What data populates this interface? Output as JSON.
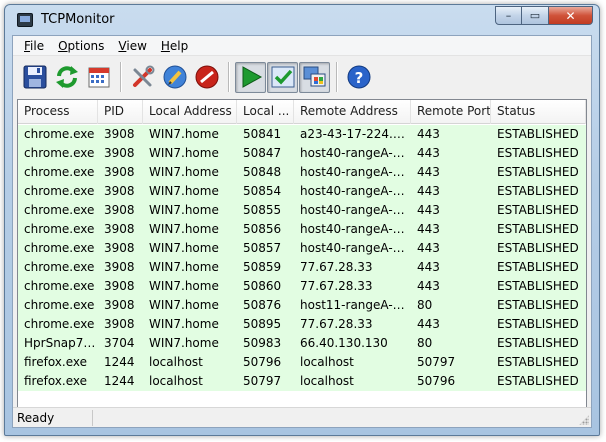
{
  "window": {
    "title": "TCPMonitor"
  },
  "caption": {
    "minimize": "–",
    "maximize": "▭",
    "close": "✕"
  },
  "menu": [
    {
      "label": "File",
      "mnemonic": "F",
      "rest": "ile"
    },
    {
      "label": "Options",
      "mnemonic": "O",
      "rest": "ptions"
    },
    {
      "label": "View",
      "mnemonic": "V",
      "rest": "iew"
    },
    {
      "label": "Help",
      "mnemonic": "H",
      "rest": "elp"
    }
  ],
  "toolbar": {
    "icons": [
      "save-icon",
      "refresh-icon",
      "calendar-icon",
      "tools-icon",
      "pencil-icon",
      "stop-icon",
      "play-icon",
      "check-icon",
      "windows-icon",
      "help-icon"
    ],
    "colors": {
      "save": "#2b4f9e",
      "refresh": "#1e9a2e",
      "play": "#1d9a30",
      "stop": "#c8241b",
      "help": "#2a63c9"
    }
  },
  "table": {
    "columns": [
      "Process",
      "PID",
      "Local Address",
      "Local ...",
      "Remote Address",
      "Remote Port",
      "Status"
    ],
    "row_color": "#e2fde2",
    "rows": [
      [
        "chrome.exe",
        "3908",
        "WIN7.home",
        "50841",
        "a23-43-17-224.de...",
        "443",
        "ESTABLISHED"
      ],
      [
        "chrome.exe",
        "3908",
        "WIN7.home",
        "50847",
        "host40-rangeA-ak...",
        "443",
        "ESTABLISHED"
      ],
      [
        "chrome.exe",
        "3908",
        "WIN7.home",
        "50848",
        "host40-rangeA-ak...",
        "443",
        "ESTABLISHED"
      ],
      [
        "chrome.exe",
        "3908",
        "WIN7.home",
        "50854",
        "host40-rangeA-ak...",
        "443",
        "ESTABLISHED"
      ],
      [
        "chrome.exe",
        "3908",
        "WIN7.home",
        "50855",
        "host40-rangeA-ak...",
        "443",
        "ESTABLISHED"
      ],
      [
        "chrome.exe",
        "3908",
        "WIN7.home",
        "50856",
        "host40-rangeA-ak...",
        "443",
        "ESTABLISHED"
      ],
      [
        "chrome.exe",
        "3908",
        "WIN7.home",
        "50857",
        "host40-rangeA-ak...",
        "443",
        "ESTABLISHED"
      ],
      [
        "chrome.exe",
        "3908",
        "WIN7.home",
        "50859",
        "77.67.28.33",
        "443",
        "ESTABLISHED"
      ],
      [
        "chrome.exe",
        "3908",
        "WIN7.home",
        "50860",
        "77.67.28.33",
        "443",
        "ESTABLISHED"
      ],
      [
        "chrome.exe",
        "3908",
        "WIN7.home",
        "50876",
        "host11-rangeA-ak...",
        "80",
        "ESTABLISHED"
      ],
      [
        "chrome.exe",
        "3908",
        "WIN7.home",
        "50895",
        "77.67.28.33",
        "443",
        "ESTABLISHED"
      ],
      [
        "HprSnap7....",
        "3704",
        "WIN7.home",
        "50983",
        "66.40.130.130",
        "80",
        "ESTABLISHED"
      ],
      [
        "firefox.exe",
        "1244",
        "localhost",
        "50796",
        "localhost",
        "50797",
        "ESTABLISHED"
      ],
      [
        "firefox.exe",
        "1244",
        "localhost",
        "50797",
        "localhost",
        "50796",
        "ESTABLISHED"
      ]
    ]
  },
  "status": {
    "text": "Ready"
  }
}
